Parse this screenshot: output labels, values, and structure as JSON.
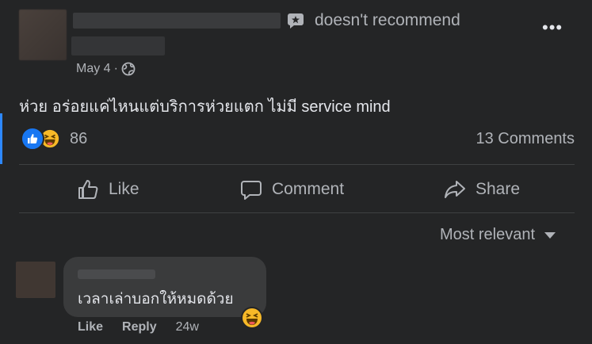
{
  "post": {
    "recommend_text": "doesn't recommend",
    "date": "May 4",
    "date_sep": "·",
    "more_label": "•••",
    "body": "ห่วย อร่อยแค่ไหนแต่บริการห่วยแตก ไม่มี service mind",
    "reaction_count": "86",
    "comments_count": "13 Comments"
  },
  "actions": {
    "like": "Like",
    "comment": "Comment",
    "share": "Share"
  },
  "sort": {
    "label": "Most relevant"
  },
  "comment": {
    "text": "เวลาเล่าบอกให้หมดด้วย",
    "like": "Like",
    "reply": "Reply",
    "age": "24w"
  },
  "colors": {
    "background": "#242526",
    "accent": "#2d88ff",
    "like_blue": "#1877f2",
    "haha_yellow": "#f7b928"
  }
}
